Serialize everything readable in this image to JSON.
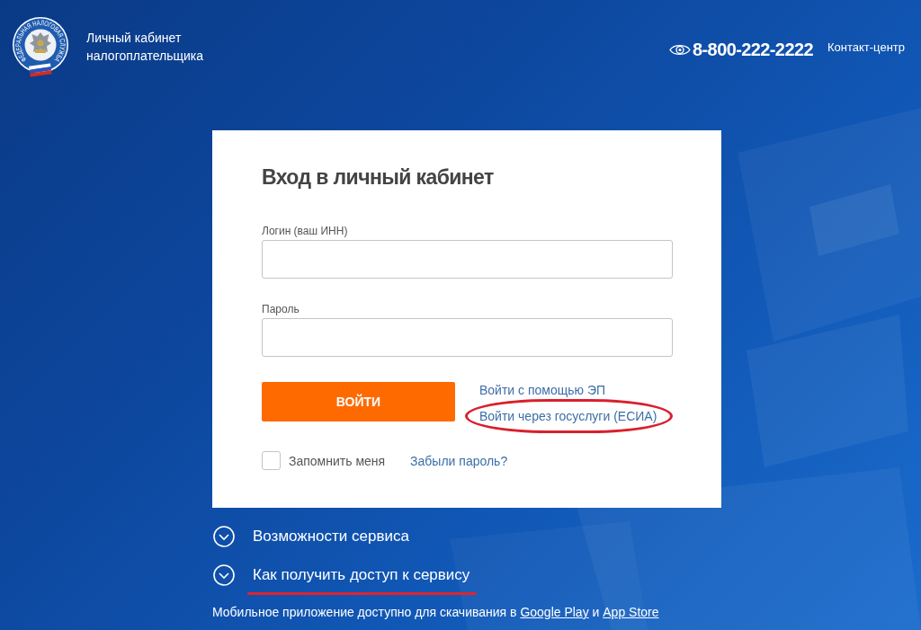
{
  "header": {
    "logo": {
      "ring_text": "ФЕДЕРАЛЬНАЯ НАЛОГОВАЯ СЛУЖБА"
    },
    "title": "Личный кабинет налогоплательщика",
    "phone": "8-800-222-2222",
    "contact_link": "Контакт-центр"
  },
  "login_card": {
    "title": "Вход в личный кабинет",
    "fields": [
      {
        "label": "Логин (ваш ИНН)"
      },
      {
        "label": "Пароль"
      }
    ],
    "submit_button": "ВОЙТИ",
    "alt_links": [
      {
        "label": "Войти с помощью ЭП",
        "highlighted": false
      },
      {
        "label": "Войти через госуслуги (ЕСИА)",
        "highlighted": true
      }
    ],
    "remember": {
      "label": "Запомнить меня",
      "checked": false
    },
    "forgot_link": "Забыли пароль?"
  },
  "accordion": [
    {
      "label": "Возможности сервиса",
      "expanded": false,
      "highlighted": false
    },
    {
      "label": "Как получить доступ к сервису",
      "expanded": false,
      "highlighted": true
    }
  ],
  "footer": {
    "text": "Мобильное приложение доступно для скачивания в",
    "links": [
      "Google Play",
      "App Store"
    ],
    "joiner": "и"
  }
}
